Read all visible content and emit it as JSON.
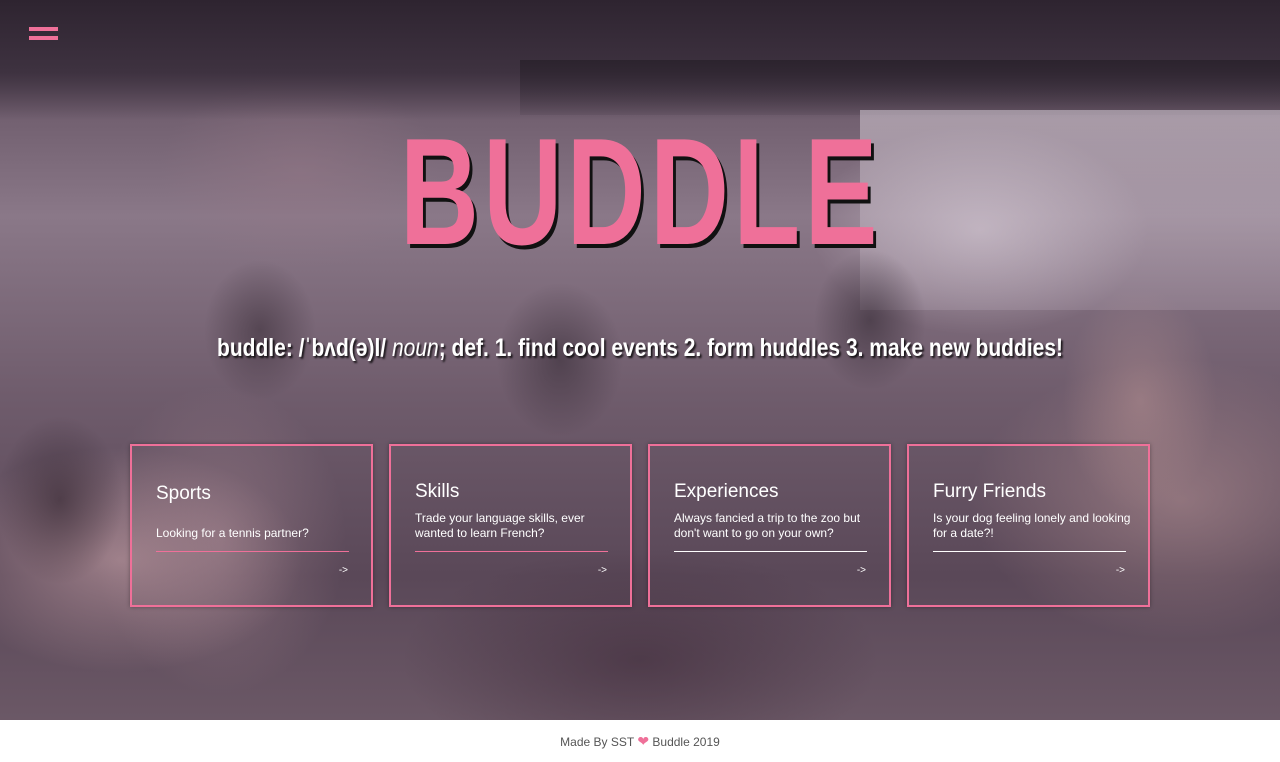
{
  "nav": {
    "menu_icon": "hamburger-menu-icon"
  },
  "hero": {
    "brand": "BUDDLE",
    "tagline": {
      "word": "buddle: /ˈbʌd(ə)l/",
      "part_of_speech": "noun",
      "definition": "; def. 1. find cool events 2. form huddles 3. make new buddies!"
    }
  },
  "cards": [
    {
      "title": "Sports",
      "description": "Looking for a tennis partner?",
      "arrow": "->",
      "rule_color": "#ef7099"
    },
    {
      "title": "Skills",
      "description": "Trade your language skills, ever wanted to learn French?",
      "arrow": "->",
      "rule_color": "#ef7099"
    },
    {
      "title": "Experiences",
      "description": "Always fancied a trip to the zoo but don't want to go on your own?",
      "arrow": "->",
      "rule_color": "#ffffff"
    },
    {
      "title": "Furry Friends",
      "description": "Is your dog feeling lonely and looking for a date?!",
      "arrow": "->",
      "rule_color": "#ffffff"
    }
  ],
  "footer": {
    "prefix": "Made By SST",
    "heart": "❤",
    "suffix": "Buddle 2019"
  },
  "colors": {
    "accent": "#ef7099",
    "text": "#ffffff",
    "footer_text": "#555555"
  }
}
